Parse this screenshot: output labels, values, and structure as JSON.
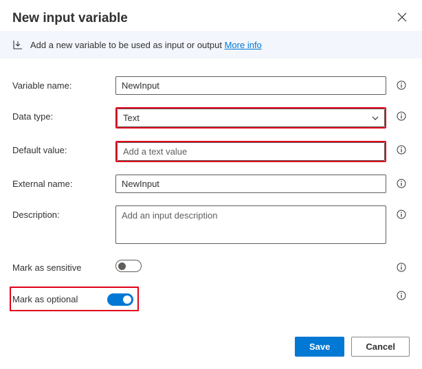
{
  "dialog": {
    "title": "New input variable"
  },
  "banner": {
    "text": "Add a new variable to be used as input or output ",
    "link": "More info"
  },
  "fields": {
    "variable_name": {
      "label": "Variable name:",
      "value": "NewInput"
    },
    "data_type": {
      "label": "Data type:",
      "value": "Text"
    },
    "default_value": {
      "label": "Default value:",
      "placeholder": "Add a text value"
    },
    "external_name": {
      "label": "External name:",
      "value": "NewInput"
    },
    "description": {
      "label": "Description:",
      "placeholder": "Add an input description"
    },
    "mark_sensitive": {
      "label": "Mark as sensitive",
      "value": false
    },
    "mark_optional": {
      "label": "Mark as optional",
      "value": true
    }
  },
  "buttons": {
    "save": "Save",
    "cancel": "Cancel"
  }
}
